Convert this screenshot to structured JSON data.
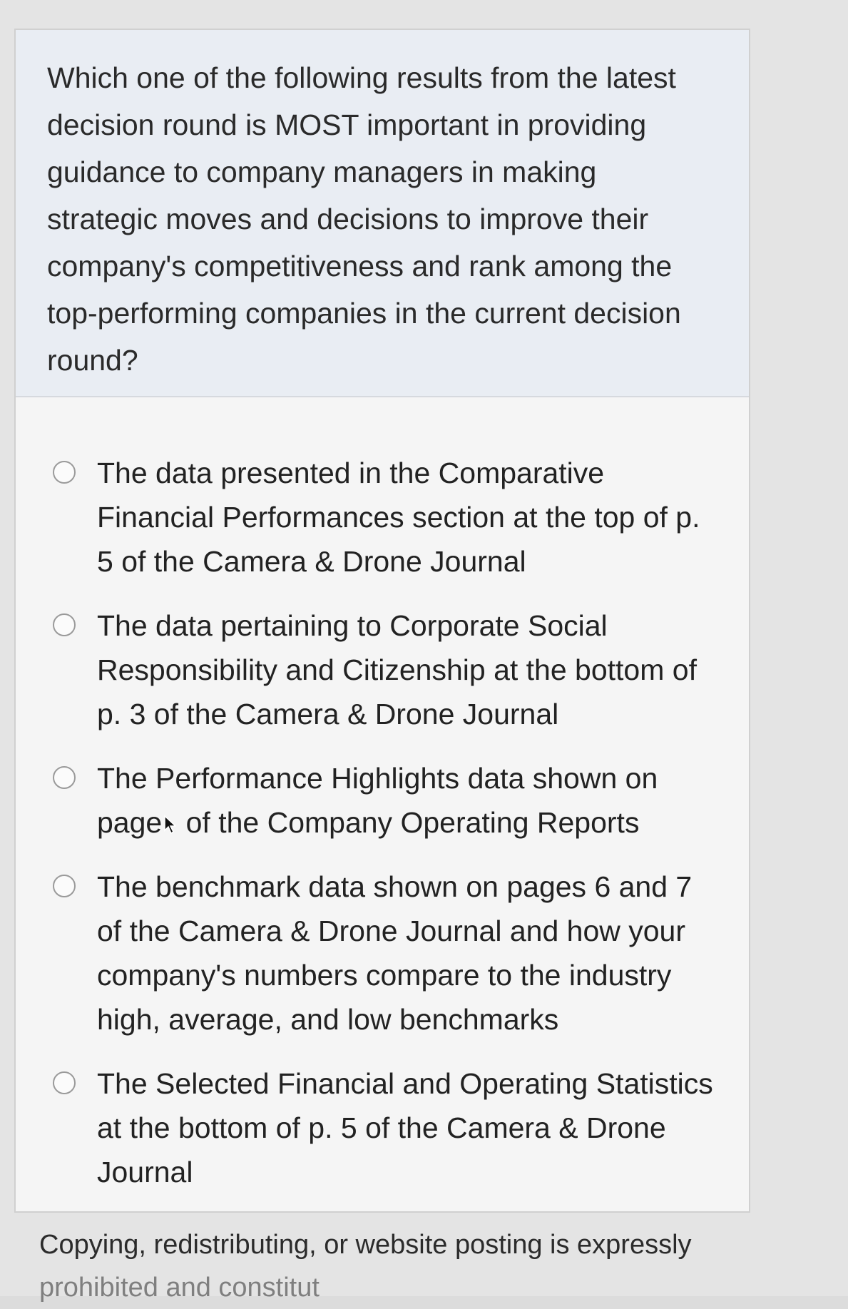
{
  "question": {
    "prompt": "Which one of the following results from the latest decision round is MOST important in providing guidance to company managers in making strategic moves and decisions to improve their company's competitiveness and rank among the top-performing companies in the current decision round?"
  },
  "answers": [
    {
      "label": "The data presented in the Comparative Financial Performances section at the top of p. 5 of the Camera & Drone Journal"
    },
    {
      "label": "The data pertaining to Corporate Social Responsibility and Citizenship at the bottom of p. 3 of the Camera & Drone Journal"
    },
    {
      "label": "The Performance Highlights data shown on page",
      "label_end": " of the Company Operating Reports"
    },
    {
      "label": "The benchmark data shown on pages 6 and 7 of the Camera & Drone Journal and how your company's numbers compare to the industry high, average, and low benchmarks"
    },
    {
      "label": "The Selected Financial and Operating Statistics at the bottom of p. 5 of the Camera & Drone Journal"
    }
  ],
  "footer": {
    "line1": "Copying, redistributing, or website posting is expressly",
    "line2": "prohibited and constitut"
  }
}
